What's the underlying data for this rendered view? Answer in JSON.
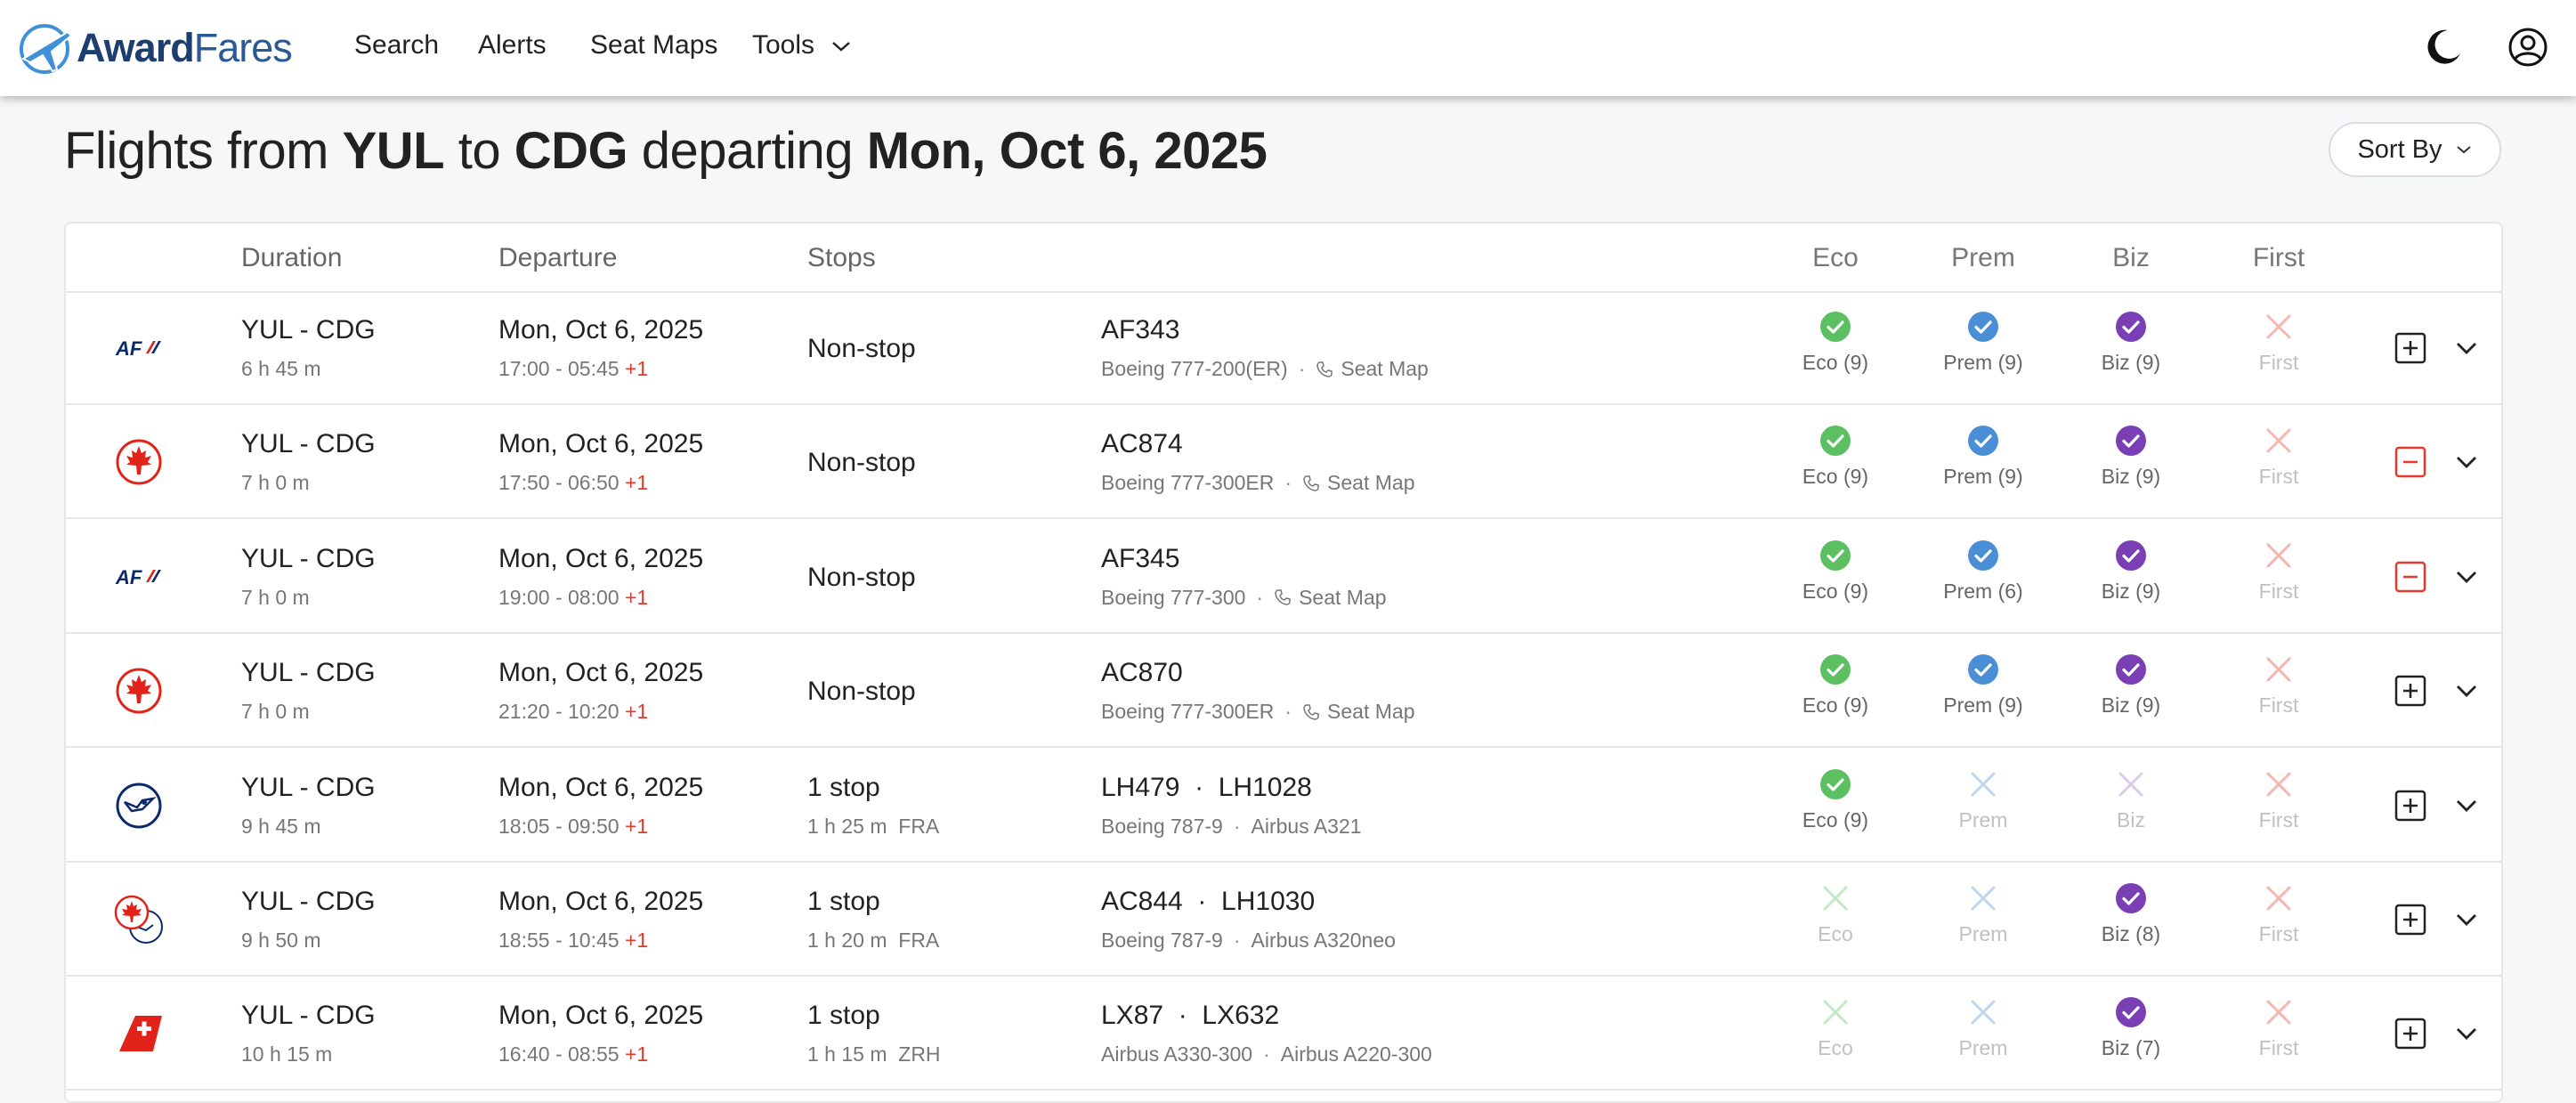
{
  "brand": {
    "name_bold": "Award",
    "name_light": "Fares"
  },
  "nav": {
    "search": "Search",
    "alerts": "Alerts",
    "seat_maps": "Seat Maps",
    "tools": "Tools"
  },
  "header_icons": [
    "moon-icon",
    "account-icon"
  ],
  "title": {
    "prefix": "Flights from",
    "origin": "YUL",
    "to": "to",
    "destination": "CDG",
    "departing": "departing",
    "date": "Mon, Oct 6, 2025"
  },
  "sort_label": "Sort By",
  "columns": {
    "duration": "Duration",
    "departure": "Departure",
    "stops": "Stops",
    "eco": "Eco",
    "prem": "Prem",
    "biz": "Biz",
    "first": "First"
  },
  "colors": {
    "eco": "#5cbf62",
    "prem": "#4a8fd6",
    "biz": "#7b3fb5",
    "first_off": "#f2b7b2",
    "eco_off": "#c4e8c6",
    "prem_off": "#bcd6f0",
    "biz_off": "#dccbea",
    "minus": "#e23b2e",
    "brand": "#1d3f6f"
  },
  "flights": [
    {
      "airline_icon": "air-france-logo",
      "route": "YUL - CDG",
      "duration": "6 h 45 m",
      "date": "Mon, Oct 6, 2025",
      "times": "17:00 - 05:45",
      "day_offset": "+1",
      "stops": "Non-stop",
      "stop_detail": "",
      "flight": "AF343",
      "aircraft": "Boeing 777-200(ER)",
      "aircraft2": "",
      "seat_map": "Seat Map",
      "eco": "Eco (9)",
      "prem": "Prem (9)",
      "biz": "Biz (9)",
      "first": "First",
      "avail": {
        "eco": true,
        "prem": true,
        "biz": true,
        "first": false
      },
      "action": "plus"
    },
    {
      "airline_icon": "air-canada-logo",
      "route": "YUL - CDG",
      "duration": "7 h 0 m",
      "date": "Mon, Oct 6, 2025",
      "times": "17:50 - 06:50",
      "day_offset": "+1",
      "stops": "Non-stop",
      "stop_detail": "",
      "flight": "AC874",
      "aircraft": "Boeing 777-300ER",
      "aircraft2": "",
      "seat_map": "Seat Map",
      "eco": "Eco (9)",
      "prem": "Prem (9)",
      "biz": "Biz (9)",
      "first": "First",
      "avail": {
        "eco": true,
        "prem": true,
        "biz": true,
        "first": false
      },
      "action": "minus"
    },
    {
      "airline_icon": "air-france-logo",
      "route": "YUL - CDG",
      "duration": "7 h 0 m",
      "date": "Mon, Oct 6, 2025",
      "times": "19:00 - 08:00",
      "day_offset": "+1",
      "stops": "Non-stop",
      "stop_detail": "",
      "flight": "AF345",
      "aircraft": "Boeing 777-300",
      "aircraft2": "",
      "seat_map": "Seat Map",
      "eco": "Eco (9)",
      "prem": "Prem (6)",
      "biz": "Biz (9)",
      "first": "First",
      "avail": {
        "eco": true,
        "prem": true,
        "biz": true,
        "first": false
      },
      "action": "minus"
    },
    {
      "airline_icon": "air-canada-logo",
      "route": "YUL - CDG",
      "duration": "7 h 0 m",
      "date": "Mon, Oct 6, 2025",
      "times": "21:20 - 10:20",
      "day_offset": "+1",
      "stops": "Non-stop",
      "stop_detail": "",
      "flight": "AC870",
      "aircraft": "Boeing 777-300ER",
      "aircraft2": "",
      "seat_map": "Seat Map",
      "eco": "Eco (9)",
      "prem": "Prem (9)",
      "biz": "Biz (9)",
      "first": "First",
      "avail": {
        "eco": true,
        "prem": true,
        "biz": true,
        "first": false
      },
      "action": "plus"
    },
    {
      "airline_icon": "lufthansa-logo",
      "route": "YUL - CDG",
      "duration": "9 h 45 m",
      "date": "Mon, Oct 6, 2025",
      "times": "18:05 - 09:50",
      "day_offset": "+1",
      "stops": "1 stop",
      "stop_detail": "1 h 25 m  FRA",
      "flight": "LH479  ·  LH1028",
      "aircraft": "Boeing 787-9",
      "aircraft2": "Airbus A321",
      "seat_map": "",
      "eco": "Eco (9)",
      "prem": "Prem",
      "biz": "Biz",
      "first": "First",
      "avail": {
        "eco": true,
        "prem": false,
        "biz": false,
        "first": false
      },
      "action": "plus"
    },
    {
      "airline_icon": "air-canada-lufthansa-logo",
      "route": "YUL - CDG",
      "duration": "9 h 50 m",
      "date": "Mon, Oct 6, 2025",
      "times": "18:55 - 10:45",
      "day_offset": "+1",
      "stops": "1 stop",
      "stop_detail": "1 h 20 m  FRA",
      "flight": "AC844  ·  LH1030",
      "aircraft": "Boeing 787-9",
      "aircraft2": "Airbus A320neo",
      "seat_map": "",
      "eco": "Eco",
      "prem": "Prem",
      "biz": "Biz (8)",
      "first": "First",
      "avail": {
        "eco": false,
        "prem": false,
        "biz": true,
        "first": false
      },
      "action": "plus"
    },
    {
      "airline_icon": "swiss-logo",
      "route": "YUL - CDG",
      "duration": "10 h 15 m",
      "date": "Mon, Oct 6, 2025",
      "times": "16:40 - 08:55",
      "day_offset": "+1",
      "stops": "1 stop",
      "stop_detail": "1 h 15 m  ZRH",
      "flight": "LX87  ·  LX632",
      "aircraft": "Airbus A330-300",
      "aircraft2": "Airbus A220-300",
      "seat_map": "",
      "eco": "Eco",
      "prem": "Prem",
      "biz": "Biz (7)",
      "first": "First",
      "avail": {
        "eco": false,
        "prem": false,
        "biz": true,
        "first": false
      },
      "action": "plus"
    }
  ]
}
